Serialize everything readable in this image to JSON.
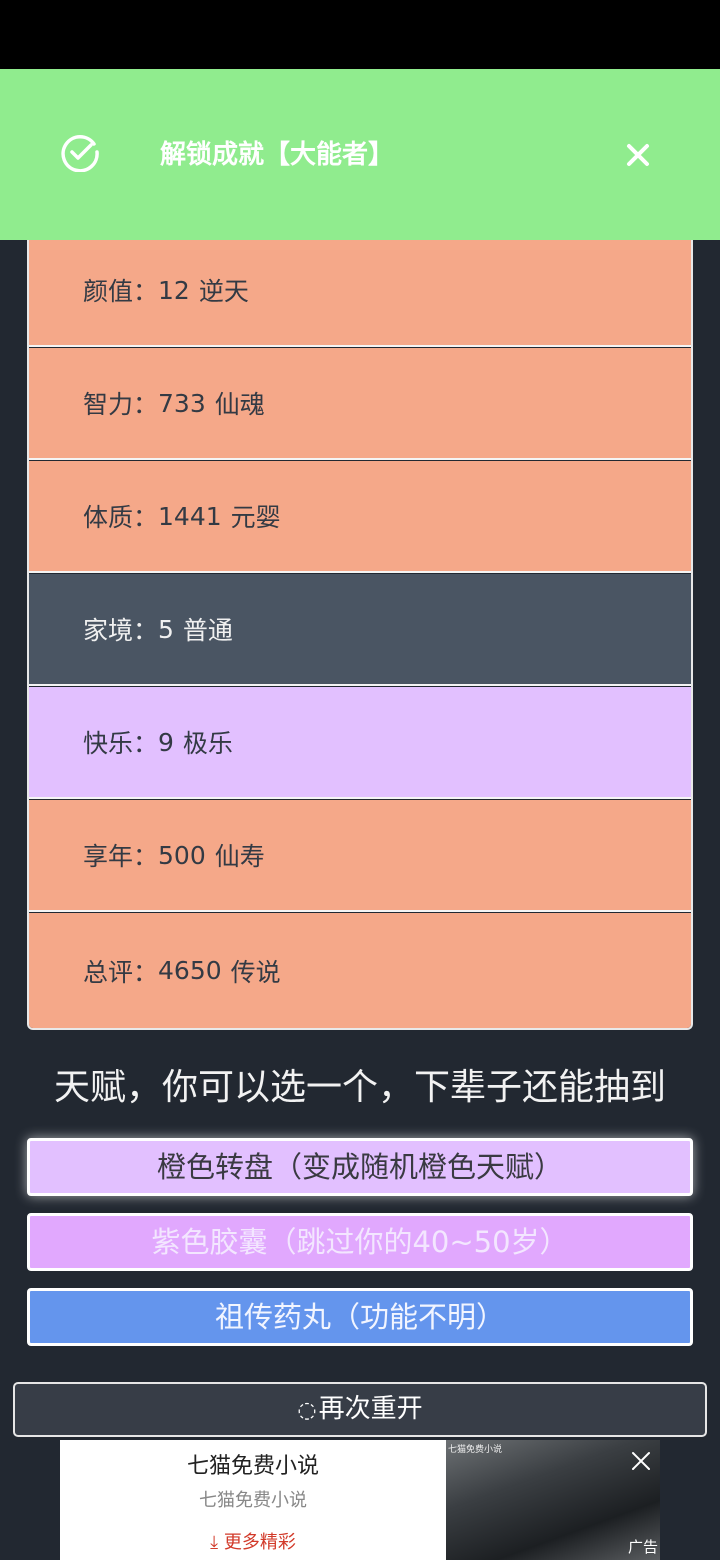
{
  "toast": {
    "title": "解锁成就【大能者】",
    "icon": "check-circle-icon",
    "close_icon": "close-icon"
  },
  "stats": [
    {
      "label": "颜值：",
      "value": "12",
      "grade": "逆天",
      "color": "#f5a889"
    },
    {
      "label": "智力：",
      "value": "733",
      "grade": "仙魂",
      "color": "#f5a889"
    },
    {
      "label": "体质：",
      "value": "1441",
      "grade": "元婴",
      "color": "#f5a889"
    },
    {
      "label": "家境：",
      "value": "5",
      "grade": "普通",
      "color": "#4a5563"
    },
    {
      "label": "快乐：",
      "value": "9",
      "grade": "极乐",
      "color": "#e2c0ff"
    },
    {
      "label": "享年：",
      "value": "500",
      "grade": "仙寿",
      "color": "#f5a889"
    },
    {
      "label": "总评：",
      "value": "4650",
      "grade": "传说",
      "color": "#f5a889"
    }
  ],
  "talent": {
    "heading": "天赋，你可以选一个，下辈子还能抽到",
    "options": [
      {
        "label": "橙色转盘（变成随机橙色天赋）",
        "color": "#e2c0ff"
      },
      {
        "label": "紫色胶囊（跳过你的40~50岁）",
        "color": "#e1a8fe"
      },
      {
        "label": "祖传药丸（功能不明）",
        "color": "#6495ed"
      }
    ]
  },
  "restart": {
    "icon": "refresh-icon",
    "label": "再次重开"
  },
  "ad": {
    "title": "七猫免费小说",
    "subtitle": "七猫免费小说",
    "more": "更多精彩",
    "tag": "广告",
    "logo_text": "七猫免费小说",
    "close_icon": "close-icon"
  }
}
